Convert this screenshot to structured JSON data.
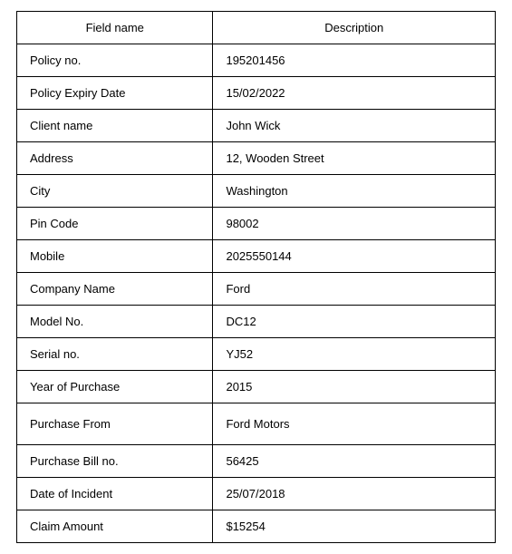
{
  "headers": {
    "field": "Field name",
    "description": "Description"
  },
  "rows": [
    {
      "field": "Policy no.",
      "value": "195201456"
    },
    {
      "field": "Policy Expiry Date",
      "value": "15/02/2022"
    },
    {
      "field": "Client name",
      "value": "John Wick"
    },
    {
      "field": "Address",
      "value": "12, Wooden Street"
    },
    {
      "field": "City",
      "value": "Washington"
    },
    {
      "field": "Pin Code",
      "value": "98002"
    },
    {
      "field": "Mobile",
      "value": "2025550144"
    },
    {
      "field": "Company Name",
      "value": "Ford"
    },
    {
      "field": "Model No.",
      "value": "DC12"
    },
    {
      "field": "Serial no.",
      "value": "YJ52"
    },
    {
      "field": "Year of Purchase",
      "value": "2015"
    },
    {
      "field": "Purchase From",
      "value": "Ford Motors"
    },
    {
      "field": "Purchase Bill no.",
      "value": "56425"
    },
    {
      "field": "Date of Incident",
      "value": "25/07/2018"
    },
    {
      "field": "Claim Amount",
      "value": "$15254"
    }
  ]
}
